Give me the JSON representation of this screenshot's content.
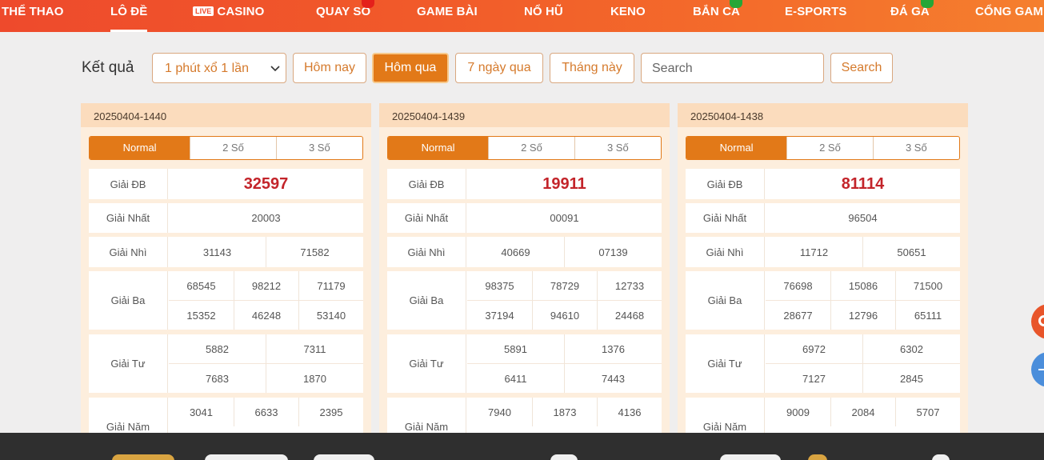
{
  "nav": {
    "items": [
      "THỂ THAO",
      "LÔ ĐỀ",
      "CASINO",
      "QUAY SỐ",
      "GAME BÀI",
      "NỔ HŨ",
      "KENO",
      "BẮN CÁ",
      "E-SPORTS",
      "ĐÁ GÀ",
      "CỔNG GAME"
    ],
    "live_badge": "LIVE",
    "active": "LÔ ĐỀ"
  },
  "filter": {
    "label": "Kết quả",
    "select_value": "1 phút xổ 1 lần",
    "buttons": [
      "Hôm nay",
      "Hôm qua",
      "7 ngày qua",
      "Tháng này"
    ],
    "active_button": "Hôm qua",
    "search_placeholder": "Search",
    "search_button": "Search"
  },
  "tabs": [
    "Normal",
    "2 Số",
    "3 Số"
  ],
  "labels": {
    "db": "Giải ĐB",
    "nhat": "Giải Nhất",
    "nhi": "Giải Nhì",
    "ba": "Giải Ba",
    "tu": "Giải Tư",
    "nam": "Giải Năm"
  },
  "cards": [
    {
      "id": "20250404-1440",
      "db": "32597",
      "nhat": "20003",
      "nhi": [
        "31143",
        "71582"
      ],
      "ba": [
        "68545",
        "98212",
        "71179",
        "15352",
        "46248",
        "53140"
      ],
      "tu": [
        "5882",
        "7311",
        "7683",
        "1870"
      ],
      "nam": [
        "3041",
        "6633",
        "2395"
      ]
    },
    {
      "id": "20250404-1439",
      "db": "19911",
      "nhat": "00091",
      "nhi": [
        "40669",
        "07139"
      ],
      "ba": [
        "98375",
        "78729",
        "12733",
        "37194",
        "94610",
        "24468"
      ],
      "tu": [
        "5891",
        "1376",
        "6411",
        "7443"
      ],
      "nam": [
        "7940",
        "1873",
        "4136"
      ]
    },
    {
      "id": "20250404-1438",
      "db": "81114",
      "nhat": "96504",
      "nhi": [
        "11712",
        "50651"
      ],
      "ba": [
        "76698",
        "15086",
        "71500",
        "28677",
        "12796",
        "65111"
      ],
      "tu": [
        "6972",
        "6302",
        "7127",
        "2845"
      ],
      "nam": [
        "9009",
        "2084",
        "5707"
      ]
    }
  ],
  "colors": {
    "accent": "#e27918",
    "nav_start": "#ee4a2c",
    "nav_end": "#f57f2e",
    "prize_red": "#c3242a",
    "card_bg": "#fdeedd",
    "footer_bg": "#2f2f2f"
  },
  "icons": {
    "select": "chevron-down-icon",
    "float_top": "chat-icon",
    "float_bottom": "minus-icon"
  }
}
